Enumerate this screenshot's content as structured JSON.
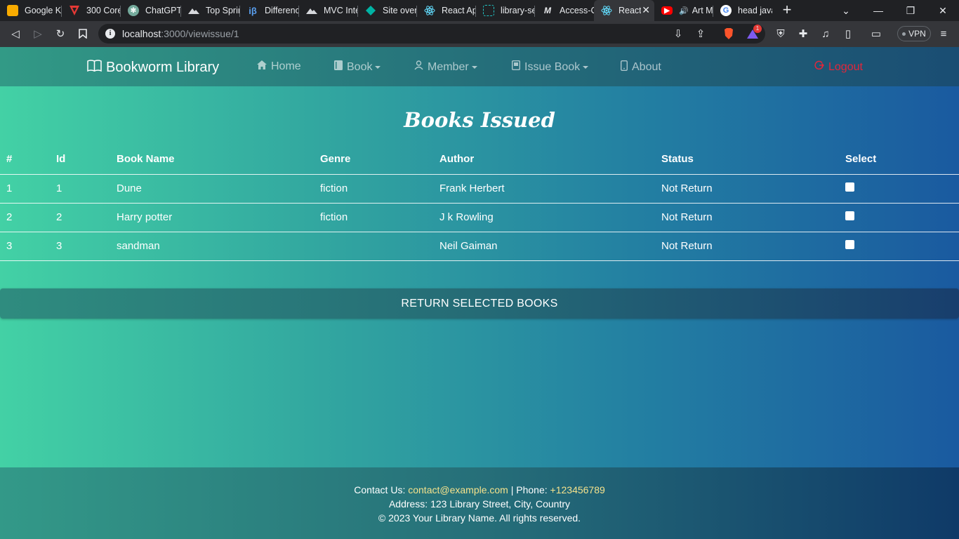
{
  "browser": {
    "tabs": [
      {
        "title": "Google K",
        "icon": "keep-icon",
        "color": "#f9ab00"
      },
      {
        "title": "300 Core",
        "icon": "v-logo-icon",
        "color": "#e53935"
      },
      {
        "title": "ChatGPT",
        "icon": "chatgpt-icon",
        "color": "#74aa9c"
      },
      {
        "title": "Top Sprin",
        "icon": "mountain-icon",
        "color": "#d6d8dc"
      },
      {
        "title": "Differenc",
        "icon": "ib-icon",
        "color": "#5aa0f0"
      },
      {
        "title": "MVC Inte",
        "icon": "mountain-icon",
        "color": "#d6d8dc"
      },
      {
        "title": "Site over",
        "icon": "diamond-icon",
        "color": "#00b3a4"
      },
      {
        "title": "React Ap",
        "icon": "react-icon",
        "color": "#61dafb"
      },
      {
        "title": "library-se",
        "icon": "library-icon",
        "color": "#22c3c3"
      },
      {
        "title": "Access-C",
        "icon": "medium-icon",
        "color": "#e8eaed"
      },
      {
        "title": "React",
        "icon": "react-icon",
        "color": "#61dafb"
      },
      {
        "title": "Art M",
        "icon": "youtube-icon",
        "color": "#ff0000"
      },
      {
        "title": "head java",
        "icon": "google-icon",
        "color": "#4285f4"
      }
    ],
    "url_host": "localhost",
    "url_path": ":3000/viewissue/1",
    "vpn_label": "VPN",
    "notification_count": "1"
  },
  "nav": {
    "brand": "Bookworm Library",
    "home": "Home",
    "book": "Book",
    "member": "Member",
    "issue_book": "Issue Book",
    "about": "About",
    "logout": "Logout"
  },
  "page_title": "Books Issued",
  "table": {
    "headers": [
      "#",
      "Id",
      "Book Name",
      "Genre",
      "Author",
      "Status",
      "Select"
    ],
    "rows": [
      {
        "index": "1",
        "id": "1",
        "book_name": "Dune",
        "genre": "fiction",
        "author": "Frank Herbert",
        "status": "Not Return",
        "selected": false
      },
      {
        "index": "2",
        "id": "2",
        "book_name": "Harry potter",
        "genre": "fiction",
        "author": "J k Rowling",
        "status": "Not Return",
        "selected": false
      },
      {
        "index": "3",
        "id": "3",
        "book_name": "sandman",
        "genre": "",
        "author": "Neil Gaiman",
        "status": "Not Return",
        "selected": false
      }
    ]
  },
  "return_button": "RETURN SELECTED BOOKS",
  "footer": {
    "contact_label": "Contact Us:",
    "email": "contact@example.com",
    "separator": "|",
    "phone_label": "Phone:",
    "phone": "+123456789",
    "address": "Address: 123 Library Street, City, Country",
    "copyright": "© 2023 Your Library Name. All rights reserved."
  }
}
